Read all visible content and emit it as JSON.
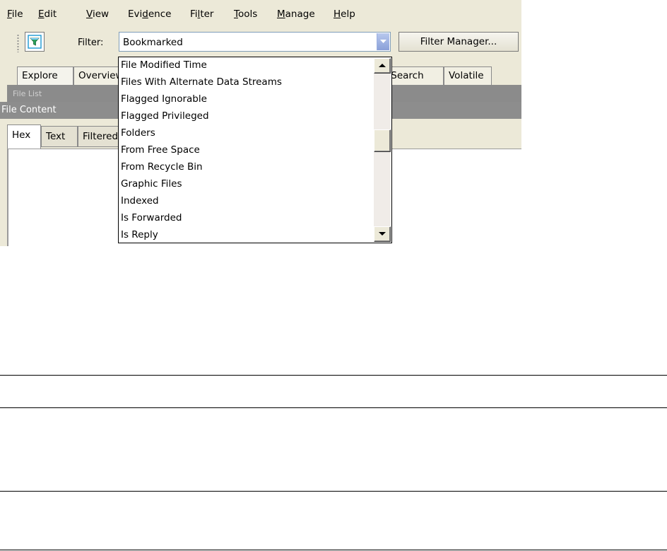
{
  "menu": {
    "items": [
      {
        "label": "File",
        "mnemonic": "F",
        "rest": "ile"
      },
      {
        "label": "Edit",
        "mnemonic": "E",
        "rest": "dit"
      },
      {
        "label": "View",
        "mnemonic": "V",
        "rest": "iew"
      },
      {
        "label": "Evidence",
        "pre": "Evi",
        "mnemonic": "d",
        "rest": "ence"
      },
      {
        "label": "Filter",
        "pre": "Fi",
        "mnemonic": "l",
        "rest": "ter"
      },
      {
        "label": "Tools",
        "mnemonic": "T",
        "rest": "ools"
      },
      {
        "label": "Manage",
        "mnemonic": "M",
        "rest": "anage"
      },
      {
        "label": "Help",
        "mnemonic": "H",
        "rest": "elp"
      }
    ]
  },
  "toolbar": {
    "filter_icon": "funnel-icon",
    "filter_label": "Filter:",
    "filter_value": "Bookmarked",
    "filter_manager_label": "Filter Manager..."
  },
  "tabs": {
    "items": [
      "Explore",
      "Overview",
      "x Search",
      "Volatile"
    ]
  },
  "file_list": {
    "title": "File List"
  },
  "file_content": {
    "title": "File Content",
    "subtabs": [
      "Hex",
      "Text",
      "Filtered"
    ]
  },
  "dropdown": {
    "options": [
      "File Modified Time",
      "Files With Alternate Data Streams",
      "Flagged Ignorable",
      "Flagged Privileged",
      "Folders",
      "From Free Space",
      "From Recycle Bin",
      "Graphic Files",
      "Indexed",
      "Is Forwarded",
      "Is Reply"
    ]
  },
  "colors": {
    "window_bg": "#ece9d8",
    "panel_header": "#8d8d8d",
    "combo_border": "#7f9db9",
    "funnel_accent": "#2a9fd6"
  }
}
